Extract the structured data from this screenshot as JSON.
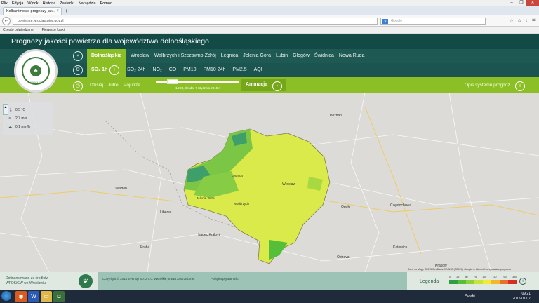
{
  "browser": {
    "menu": [
      "Plik",
      "Edycja",
      "Widok",
      "Historia",
      "Zakładki",
      "Narzędzia",
      "Pomoc"
    ],
    "tab_title": "Kolbanimowe prognozy jak...",
    "url": "powietrze.wroclaw.pios.gov.pl",
    "search_placeholder": "Google",
    "bookmarks": [
      "Często odwiedzane",
      "Pierwsze kroki"
    ]
  },
  "site": {
    "title": "Prognozy jakości powietrza dla województwa dolnośląskiego",
    "logo_text": "WROCŁAW",
    "regions": {
      "active": "Dolnośląskie",
      "items": [
        "Wrocław",
        "Wałbrzych i Szczawno-Zdrój",
        "Legnica",
        "Jelenia Góra",
        "Lubin",
        "Głogów",
        "Świdnica",
        "Nowa Ruda"
      ]
    },
    "params": {
      "active": "SO₂ 1h",
      "items": [
        "SO₂ 24h",
        "NO₂",
        "CO",
        "PM10",
        "PM10 24h",
        "PM2.5",
        "AQI"
      ]
    },
    "time": {
      "days": [
        "Dzisiaj",
        "Jutro",
        "Pojutrze"
      ],
      "slider_label": "14:00, Środa, 7 Stycznia 2015 r.",
      "animation_label": "Animacja",
      "description_label": "Opis systemu prognoz"
    }
  },
  "weather": {
    "temperature": "0.5 °C",
    "wind": "2.7 m/s",
    "humidity": "0.1 mm/h"
  },
  "map": {
    "cities": [
      "Wrocław",
      "Legnica",
      "Jelenia Góra",
      "Wałbrzych",
      "Opole",
      "Dresden",
      "Praha",
      "Katowice",
      "Kraków",
      "Poznań",
      "Ostrava",
      "Hradec Králové",
      "Liberec",
      "Częstochowa"
    ],
    "attribution": "Dane do Mapy ©2015 GeoBasis-DE/BKG (©2009), Google — Warunki korzystania z programu"
  },
  "footer": {
    "cofund": [
      "Dofinansowano ze środków",
      "WFOŚiGW we Wrocławiu"
    ],
    "copyright": "Copyright © 2014 Evertop Sp. z o.o. Wszelkie prawa zastrzeżone.",
    "policy": "Polityka prywatności",
    "legend_title": "Legenda",
    "legend_colors": [
      "#2f9e44",
      "#56bf3a",
      "#8fd136",
      "#c7e43a",
      "#f2ea3a",
      "#f2b632",
      "#e8702a",
      "#d62e24"
    ],
    "legend_values": [
      "0",
      "25",
      "50",
      "75",
      "100",
      "150",
      "200",
      "350"
    ]
  },
  "taskbar": {
    "lang": "Polski",
    "time": "09:21",
    "date": "2015-01-07"
  }
}
